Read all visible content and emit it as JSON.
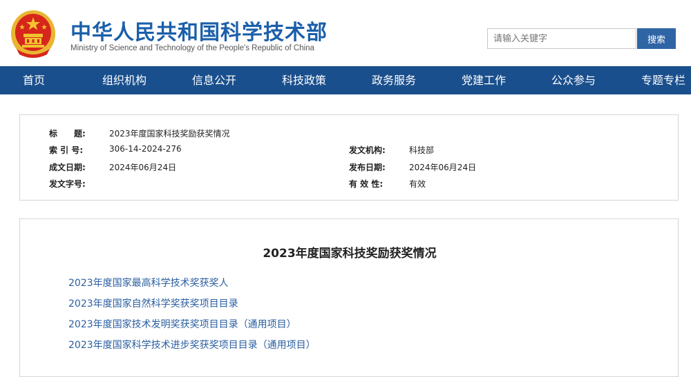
{
  "header": {
    "title": "中华人民共和国科学技术部",
    "subtitle": "Ministry of Science and Technology of the People's Republic of China",
    "emblem_icon": "national-emblem-icon",
    "search": {
      "placeholder": "请输入关键字",
      "button_label": "搜索"
    }
  },
  "nav": {
    "items": [
      {
        "label": "首页"
      },
      {
        "label": "组织机构"
      },
      {
        "label": "信息公开"
      },
      {
        "label": "科技政策"
      },
      {
        "label": "政务服务"
      },
      {
        "label": "党建工作"
      },
      {
        "label": "公众参与"
      },
      {
        "label": "专题专栏"
      }
    ]
  },
  "meta": {
    "title_label": "标　　题:",
    "title_value": "2023年度国家科技奖励获奖情况",
    "index_label": "索 引 号:",
    "index_value": "306-14-2024-276",
    "issuer_label": "发文机构:",
    "issuer_value": "科技部",
    "created_label": "成文日期:",
    "created_value": "2024年06月24日",
    "published_label": "发布日期:",
    "published_value": "2024年06月24日",
    "docno_label": "发文字号:",
    "docno_value": "",
    "validity_label": "有 效 性:",
    "validity_value": "有效"
  },
  "article": {
    "title": "2023年度国家科技奖励获奖情况",
    "links": [
      "2023年度国家最高科学技术奖获奖人",
      "2023年度国家自然科学奖获奖项目目录",
      "2023年度国家技术发明奖获奖项目目录（通用项目）",
      "2023年度国家科学技术进步奖获奖项目目录（通用项目）"
    ]
  },
  "colors": {
    "brand_blue": "#1b5faa",
    "nav_bg": "#1a4f8d",
    "link_blue": "#2a5ea0",
    "emblem_red": "#d7261b",
    "emblem_gold": "#f2c230"
  }
}
